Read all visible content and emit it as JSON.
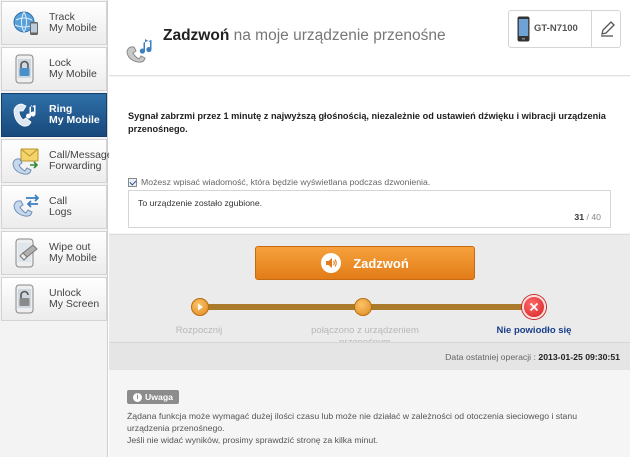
{
  "sidebar": {
    "items": [
      {
        "label_line1": "Track",
        "label_line2": "My Mobile",
        "icon": "globe-phone-icon",
        "active": false
      },
      {
        "label_line1": "Lock",
        "label_line2": "My Mobile",
        "icon": "lock-phone-icon",
        "active": false
      },
      {
        "label_line1": "Ring",
        "label_line2": "My Mobile",
        "icon": "ring-phone-icon",
        "active": true
      },
      {
        "label_line1": "Call/Message",
        "label_line2": "Forwarding",
        "icon": "forwarding-icon",
        "active": false
      },
      {
        "label_line1": "Call",
        "label_line2": "Logs",
        "icon": "call-logs-icon",
        "active": false
      },
      {
        "label_line1": "Wipe out",
        "label_line2": "My Mobile",
        "icon": "wipe-phone-icon",
        "active": false
      },
      {
        "label_line1": "Unlock",
        "label_line2": "My Screen",
        "icon": "unlock-screen-icon",
        "active": false
      }
    ]
  },
  "header": {
    "title_bold": "Zadzwoń",
    "title_rest": "na moje urządzenie przenośne",
    "device_name": "GT-N7100",
    "edit_icon": "pencil-icon"
  },
  "description": "Sygnał zabrzmi przez 1 minutę z najwyższą głośnością, niezależnie od ustawień dźwięku i wibracji urządzenia przenośnego.",
  "message": {
    "checkbox_checked": true,
    "label": "Możesz wpisać wiadomość, która będzie wyświetlana podczas dzwonienia.",
    "text": "To urządzenie zostało zgubione.",
    "count_current": "31",
    "count_sep": " / ",
    "count_max": "40"
  },
  "ring_button": {
    "label": "Zadzwoń",
    "icon": "speaker-icon"
  },
  "steps": [
    {
      "label": "Rozpocznij",
      "state": "done"
    },
    {
      "label": "połączono z urządzeniem przenośnym",
      "state": "done"
    },
    {
      "label": "Nie powiodło się",
      "state": "failed"
    }
  ],
  "last_operation": {
    "label": "Data ostatniej operacji :",
    "value": "2013-01-25 09:30:51"
  },
  "note": {
    "badge": "Uwaga",
    "line1": "Żądana funkcja może wymagać dużej ilości czasu lub może nie działać w zależności od otoczenia sieciowego i stanu urządzenia przenośnego.",
    "line2": "Jeśli nie widać wyników, prosimy sprawdzić stronę za kilka minut."
  },
  "colors": {
    "accent": "#e88a22",
    "active_nav": "#1f5a95",
    "failed": "#e53935",
    "failed_label": "#1a3f8a"
  }
}
